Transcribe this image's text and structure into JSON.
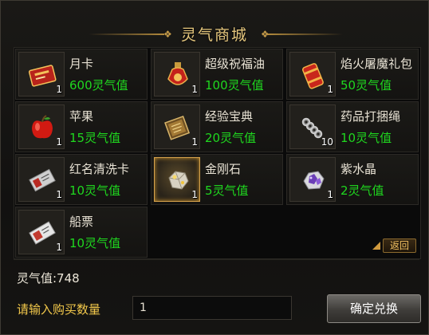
{
  "window": {
    "title": "灵气商城"
  },
  "shop": {
    "items": [
      {
        "name": "月卡",
        "price": "600灵气值",
        "qty": "1",
        "icon": "month-card-icon",
        "selected": false
      },
      {
        "name": "超级祝福油",
        "price": "100灵气值",
        "qty": "1",
        "icon": "blessing-oil-icon",
        "selected": false
      },
      {
        "name": "焰火屠魔礼包",
        "price": "50灵气值",
        "qty": "1",
        "icon": "firework-pack-icon",
        "selected": false
      },
      {
        "name": "苹果",
        "price": "15灵气值",
        "qty": "1",
        "icon": "apple-icon",
        "selected": false
      },
      {
        "name": "经验宝典",
        "price": "20灵气值",
        "qty": "1",
        "icon": "exp-book-icon",
        "selected": false
      },
      {
        "name": "药品打捆绳",
        "price": "10灵气值",
        "qty": "10",
        "icon": "rope-icon",
        "selected": false
      },
      {
        "name": "红名清洗卡",
        "price": "10灵气值",
        "qty": "1",
        "icon": "red-name-card-icon",
        "selected": false
      },
      {
        "name": "金刚石",
        "price": "5灵气值",
        "qty": "1",
        "icon": "diamond-icon",
        "selected": true
      },
      {
        "name": "紫水晶",
        "price": "2灵气值",
        "qty": "1",
        "icon": "amethyst-icon",
        "selected": false
      },
      {
        "name": "船票",
        "price": "10灵气值",
        "qty": "1",
        "icon": "ship-ticket-icon",
        "selected": false
      }
    ],
    "back_label": "返回"
  },
  "footer": {
    "balance": "灵气值:748",
    "prompt": "请输入购买数量",
    "quantity_value": "1",
    "confirm_label": "确定兑换"
  },
  "colors": {
    "accent_gold": "#e6c77d",
    "price_green": "#1fd81f",
    "prompt_yellow": "#f2c84b"
  }
}
